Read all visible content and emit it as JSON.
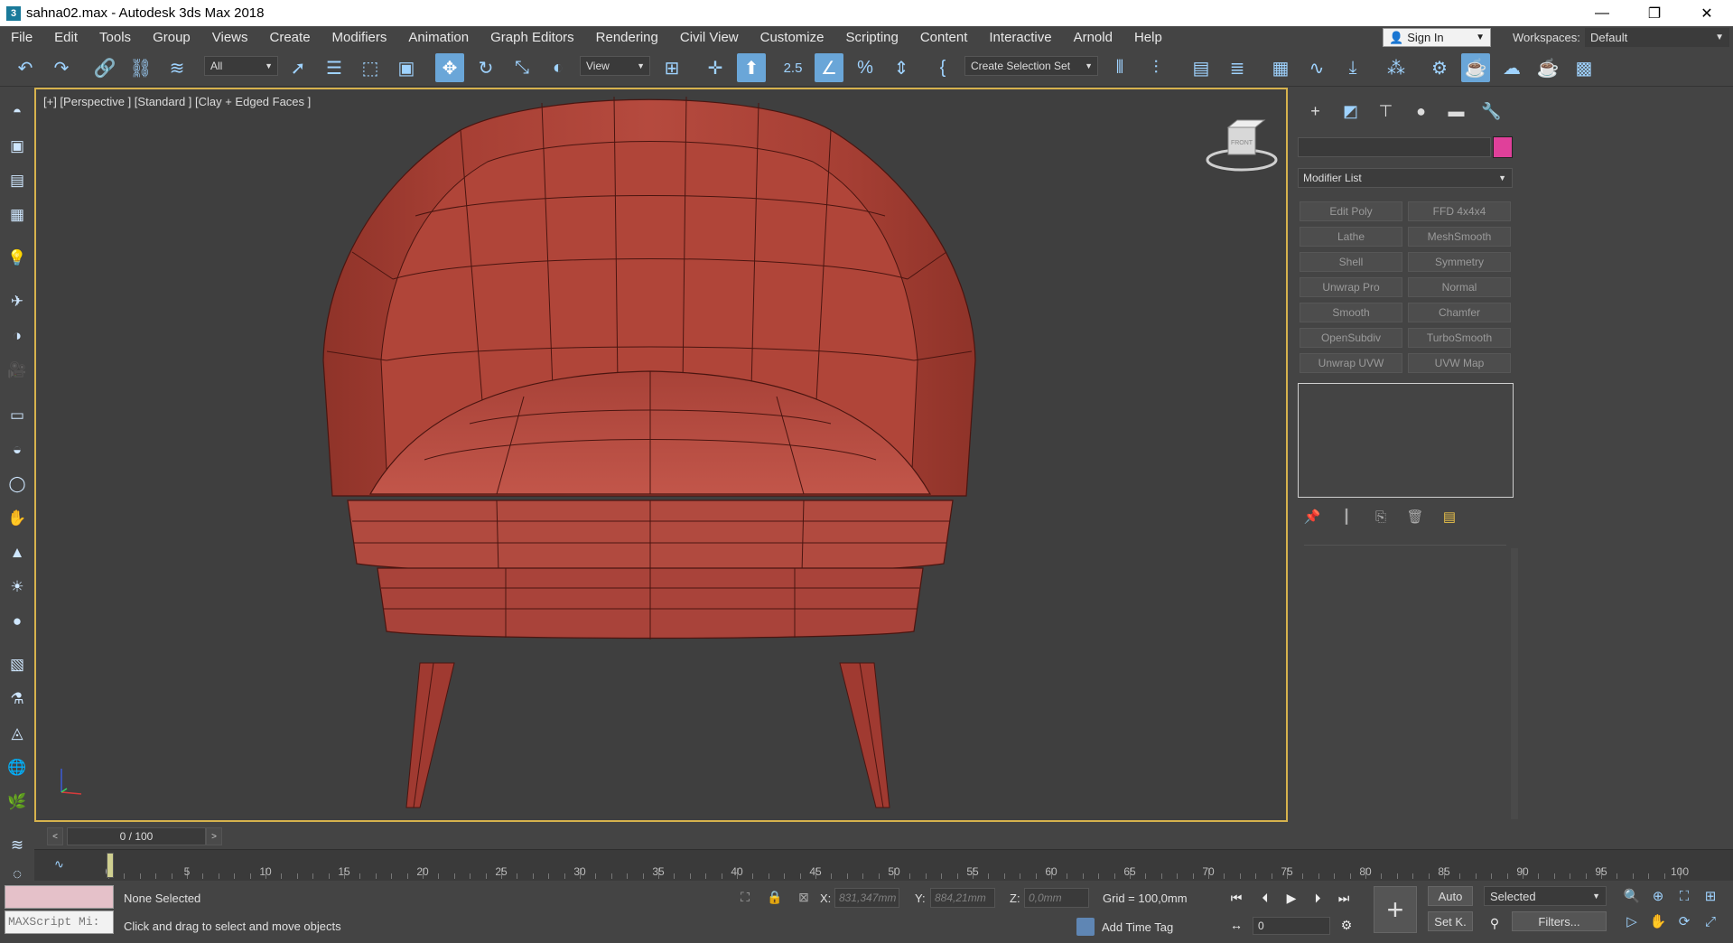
{
  "window": {
    "app_icon": "3",
    "title": "sahna02.max - Autodesk 3ds Max 2018",
    "controls": [
      "—",
      "❐",
      "✕"
    ]
  },
  "menu": {
    "items": [
      "File",
      "Edit",
      "Tools",
      "Group",
      "Views",
      "Create",
      "Modifiers",
      "Animation",
      "Graph Editors",
      "Rendering",
      "Civil View",
      "Customize",
      "Scripting",
      "Content",
      "Interactive",
      "Arnold",
      "Help"
    ],
    "sign_in": "Sign In",
    "workspaces_label": "Workspaces:",
    "workspace_value": "Default"
  },
  "toolbar": {
    "selection_filter": "All",
    "reference_coord": "View",
    "snap_label": "2.5",
    "selection_set": "Create Selection Set"
  },
  "viewport": {
    "label": "[+] [Perspective ] [Standard ] [Clay + Edged Faces ]",
    "viewcube_face": "FRONT",
    "accent_color": "#d6b24d",
    "model_color": "#b4473c"
  },
  "command_panel": {
    "object_color": "#e0409a",
    "modifier_list": "Modifier List",
    "modifiers": [
      "Edit Poly",
      "FFD 4x4x4",
      "Lathe",
      "MeshSmooth",
      "Shell",
      "Symmetry",
      "Unwrap Pro",
      "Normal",
      "Smooth",
      "Chamfer",
      "OpenSubdiv",
      "TurboSmooth",
      "Unwrap UVW",
      "UVW Map"
    ]
  },
  "timeline": {
    "frame_display": "0 / 100",
    "prev": "<",
    "next": ">",
    "ticks": [
      "0",
      "5",
      "10",
      "15",
      "20",
      "25",
      "30",
      "35",
      "40",
      "45",
      "50",
      "55",
      "60",
      "65",
      "70",
      "75",
      "80",
      "85",
      "90",
      "95",
      "100"
    ]
  },
  "status": {
    "maxscript": "MAXScript Mi:",
    "selection": "None Selected",
    "hint": "Click and drag to select and move objects",
    "x_label": "X:",
    "x_value": "831,347mm",
    "y_label": "Y:",
    "y_value": "884,21mm",
    "z_label": "Z:",
    "z_value": "0,0mm",
    "grid": "Grid = 100,0mm",
    "add_time_tag": "Add Time Tag",
    "current_frame": "0",
    "auto_key": "Auto",
    "set_key": "Set K.",
    "key_mode": "Selected",
    "filters": "Filters..."
  }
}
